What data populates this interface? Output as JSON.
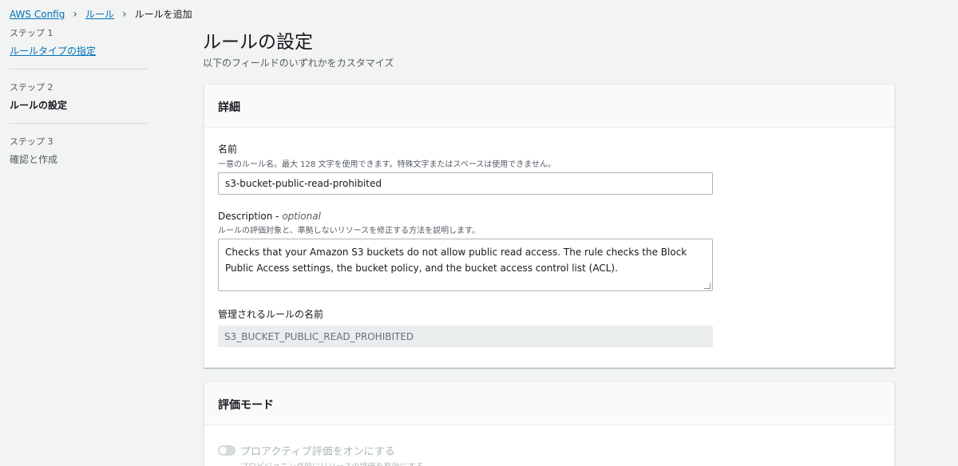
{
  "breadcrumb": {
    "root": "AWS Config",
    "rules": "ルール",
    "current": "ルールを追加"
  },
  "steps": [
    {
      "num": "ステップ 1",
      "label": "ルールタイプの指定"
    },
    {
      "num": "ステップ 2",
      "label": "ルールの設定"
    },
    {
      "num": "ステップ 3",
      "label": "確認と作成"
    }
  ],
  "page": {
    "title": "ルールの設定",
    "subtitle": "以下のフィールドのいずれかをカスタマイズ"
  },
  "details": {
    "header": "詳細",
    "name_label": "名前",
    "name_desc": "一意のルール名。最大 128 文字を使用できます。特殊文字またはスペースは使用できません。",
    "name_value": "s3-bucket-public-read-prohibited",
    "description_label": "Description - ",
    "description_optional": "optional",
    "description_desc": "ルールの評価対象と、準拠しないリソースを修正する方法を説明します。",
    "description_value": "Checks that your Amazon S3 buckets do not allow public read access. The rule checks the Block Public Access settings, the bucket policy, and the bucket access control list (ACL).",
    "managed_label": "管理されるルールの名前",
    "managed_value": "S3_BUCKET_PUBLIC_READ_PROHIBITED"
  },
  "evaluation": {
    "header": "評価モード",
    "toggle_label": "プロアクティブ評価をオンにする",
    "toggle_desc": "プロビジョニング前にリソースの評価を有効にする",
    "toggle_on": false
  }
}
